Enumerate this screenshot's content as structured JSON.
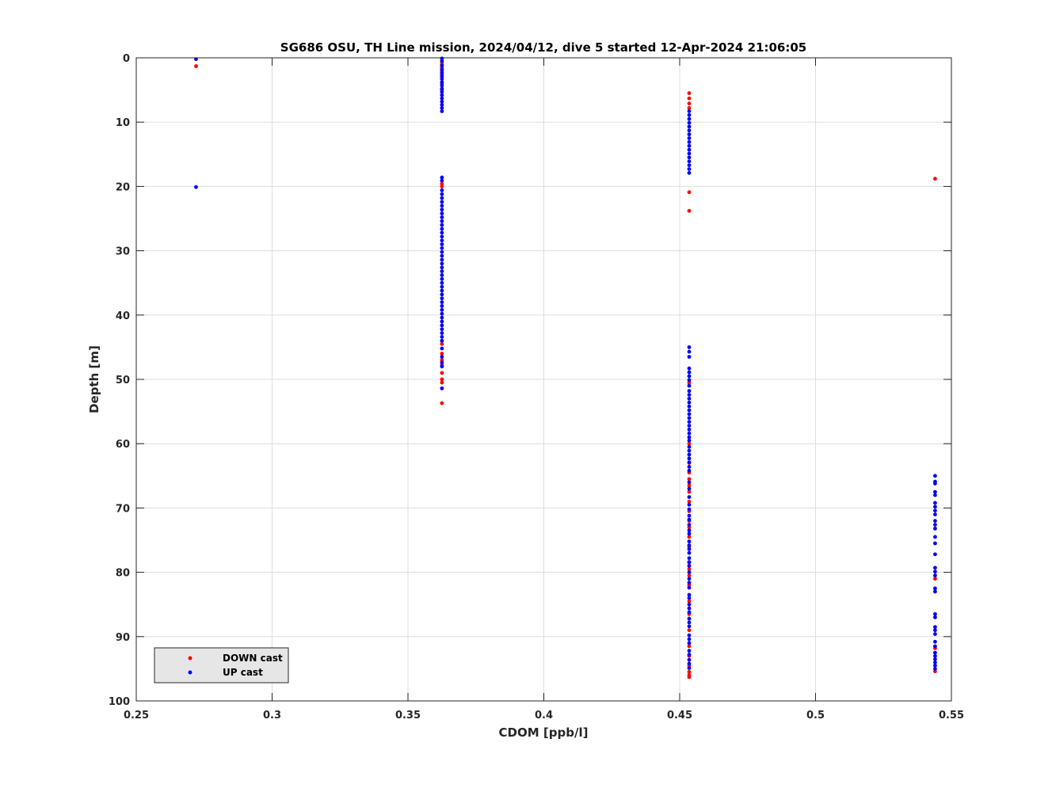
{
  "chart_data": {
    "type": "scatter",
    "title": "SG686 OSU, TH Line mission, 2024/04/12, dive 5 started 12-Apr-2024 21:06:05",
    "xlabel": "CDOM [ppb/l]",
    "ylabel": "Depth [m]",
    "xlim": [
      0.25,
      0.55
    ],
    "ylim": [
      0,
      100
    ],
    "y_reversed": true,
    "grid": true,
    "legend_position": "bottom-left",
    "xticks": [
      0.25,
      0.3,
      0.35,
      0.4,
      0.45,
      0.5,
      0.55
    ],
    "xtick_labels": [
      "0.25",
      "0.3",
      "0.35",
      "0.4",
      "0.45",
      "0.5",
      "0.55"
    ],
    "yticks": [
      0,
      10,
      20,
      30,
      40,
      50,
      60,
      70,
      80,
      90,
      100
    ],
    "ytick_labels": [
      "0",
      "10",
      "20",
      "30",
      "40",
      "50",
      "60",
      "70",
      "80",
      "90",
      "100"
    ],
    "series": [
      {
        "name": "DOWN cast",
        "color": "#ff0000",
        "points": [
          [
            0.272,
            1.3
          ],
          [
            0.3625,
            0.6
          ],
          [
            0.3625,
            1.0
          ],
          [
            0.3625,
            1.5
          ],
          [
            0.3625,
            2.0
          ],
          [
            0.3625,
            2.5
          ],
          [
            0.3625,
            3.0
          ],
          [
            0.3625,
            4.0
          ],
          [
            0.3625,
            5.0
          ],
          [
            0.3625,
            19.6
          ],
          [
            0.3625,
            20.0
          ],
          [
            0.3625,
            44.5
          ],
          [
            0.3625,
            46.0
          ],
          [
            0.3625,
            47.0
          ],
          [
            0.3625,
            47.8
          ],
          [
            0.3625,
            49.0
          ],
          [
            0.3625,
            50.0
          ],
          [
            0.3625,
            50.5
          ],
          [
            0.3625,
            53.7
          ],
          [
            0.4535,
            5.5
          ],
          [
            0.4535,
            6.3
          ],
          [
            0.4535,
            7.1
          ],
          [
            0.4535,
            7.8
          ],
          [
            0.4535,
            20.9
          ],
          [
            0.4535,
            23.8
          ],
          [
            0.4535,
            50.5
          ],
          [
            0.4535,
            60.0
          ],
          [
            0.4535,
            63.0
          ],
          [
            0.4535,
            64.5
          ],
          [
            0.4535,
            65.5
          ],
          [
            0.4535,
            66.5
          ],
          [
            0.4535,
            67.5
          ],
          [
            0.4535,
            69.0
          ],
          [
            0.4535,
            70.5
          ],
          [
            0.4535,
            72.0
          ],
          [
            0.4535,
            73.0
          ],
          [
            0.4535,
            74.5
          ],
          [
            0.4535,
            76.0
          ],
          [
            0.4535,
            78.5
          ],
          [
            0.4535,
            79.5
          ],
          [
            0.4535,
            80.5
          ],
          [
            0.4535,
            82.0
          ],
          [
            0.4535,
            84.5
          ],
          [
            0.4535,
            86.5
          ],
          [
            0.4535,
            89.0
          ],
          [
            0.4535,
            91.5
          ],
          [
            0.4535,
            93.0
          ],
          [
            0.4535,
            94.5
          ],
          [
            0.4535,
            95.5
          ],
          [
            0.4535,
            96.0
          ],
          [
            0.4535,
            96.3
          ],
          [
            0.544,
            18.8
          ],
          [
            0.544,
            81.0
          ],
          [
            0.544,
            91.8
          ],
          [
            0.544,
            95.4
          ]
        ]
      },
      {
        "name": "UP cast",
        "color": "#0000ff",
        "points": [
          [
            0.272,
            0.2
          ],
          [
            0.272,
            20.1
          ],
          [
            0.3625,
            0.1
          ],
          [
            0.3625,
            0.5
          ],
          [
            0.3625,
            1.2
          ],
          [
            0.3625,
            1.8
          ],
          [
            0.3625,
            2.3
          ],
          [
            0.3625,
            2.8
          ],
          [
            0.3625,
            3.3
          ],
          [
            0.3625,
            3.8
          ],
          [
            0.3625,
            4.3
          ],
          [
            0.3625,
            4.8
          ],
          [
            0.3625,
            5.3
          ],
          [
            0.3625,
            5.8
          ],
          [
            0.3625,
            6.3
          ],
          [
            0.3625,
            6.8
          ],
          [
            0.3625,
            7.3
          ],
          [
            0.3625,
            7.8
          ],
          [
            0.3625,
            8.3
          ],
          [
            0.3625,
            18.6
          ],
          [
            0.3625,
            19.1
          ],
          [
            0.3625,
            20.6
          ],
          [
            0.3625,
            21.2
          ],
          [
            0.3625,
            21.8
          ],
          [
            0.3625,
            22.4
          ],
          [
            0.3625,
            23.0
          ],
          [
            0.3625,
            23.6
          ],
          [
            0.3625,
            24.2
          ],
          [
            0.3625,
            24.8
          ],
          [
            0.3625,
            25.4
          ],
          [
            0.3625,
            26.0
          ],
          [
            0.3625,
            26.6
          ],
          [
            0.3625,
            27.2
          ],
          [
            0.3625,
            27.8
          ],
          [
            0.3625,
            28.4
          ],
          [
            0.3625,
            29.0
          ],
          [
            0.3625,
            29.6
          ],
          [
            0.3625,
            30.2
          ],
          [
            0.3625,
            30.8
          ],
          [
            0.3625,
            31.4
          ],
          [
            0.3625,
            32.0
          ],
          [
            0.3625,
            32.6
          ],
          [
            0.3625,
            33.2
          ],
          [
            0.3625,
            33.8
          ],
          [
            0.3625,
            34.4
          ],
          [
            0.3625,
            35.0
          ],
          [
            0.3625,
            35.6
          ],
          [
            0.3625,
            36.2
          ],
          [
            0.3625,
            36.8
          ],
          [
            0.3625,
            37.4
          ],
          [
            0.3625,
            38.0
          ],
          [
            0.3625,
            38.6
          ],
          [
            0.3625,
            39.2
          ],
          [
            0.3625,
            39.8
          ],
          [
            0.3625,
            40.4
          ],
          [
            0.3625,
            41.0
          ],
          [
            0.3625,
            41.6
          ],
          [
            0.3625,
            42.2
          ],
          [
            0.3625,
            42.8
          ],
          [
            0.3625,
            43.4
          ],
          [
            0.3625,
            44.0
          ],
          [
            0.3625,
            45.2
          ],
          [
            0.3625,
            46.5
          ],
          [
            0.3625,
            47.4
          ],
          [
            0.3625,
            48.0
          ],
          [
            0.3625,
            51.4
          ],
          [
            0.4535,
            8.3
          ],
          [
            0.4535,
            8.9
          ],
          [
            0.4535,
            9.5
          ],
          [
            0.4535,
            10.1
          ],
          [
            0.4535,
            10.7
          ],
          [
            0.4535,
            11.3
          ],
          [
            0.4535,
            11.9
          ],
          [
            0.4535,
            12.5
          ],
          [
            0.4535,
            13.1
          ],
          [
            0.4535,
            13.7
          ],
          [
            0.4535,
            14.3
          ],
          [
            0.4535,
            14.9
          ],
          [
            0.4535,
            15.5
          ],
          [
            0.4535,
            16.1
          ],
          [
            0.4535,
            16.7
          ],
          [
            0.4535,
            17.3
          ],
          [
            0.4535,
            17.9
          ],
          [
            0.4535,
            45.0
          ],
          [
            0.4535,
            45.7
          ],
          [
            0.4535,
            46.5
          ],
          [
            0.4535,
            48.3
          ],
          [
            0.4535,
            48.9
          ],
          [
            0.4535,
            49.5
          ],
          [
            0.4535,
            50.1
          ],
          [
            0.4535,
            51.0
          ],
          [
            0.4535,
            51.8
          ],
          [
            0.4535,
            52.4
          ],
          [
            0.4535,
            53.0
          ],
          [
            0.4535,
            53.6
          ],
          [
            0.4535,
            54.2
          ],
          [
            0.4535,
            54.8
          ],
          [
            0.4535,
            55.4
          ],
          [
            0.4535,
            56.0
          ],
          [
            0.4535,
            56.6
          ],
          [
            0.4535,
            57.2
          ],
          [
            0.4535,
            57.8
          ],
          [
            0.4535,
            58.4
          ],
          [
            0.4535,
            59.0
          ],
          [
            0.4535,
            59.5
          ],
          [
            0.4535,
            60.5
          ],
          [
            0.4535,
            61.1
          ],
          [
            0.4535,
            61.7
          ],
          [
            0.4535,
            62.3
          ],
          [
            0.4535,
            62.9
          ],
          [
            0.4535,
            63.6
          ],
          [
            0.4535,
            64.2
          ],
          [
            0.4535,
            66.0
          ],
          [
            0.4535,
            67.0
          ],
          [
            0.4535,
            68.3
          ],
          [
            0.4535,
            69.5
          ],
          [
            0.4535,
            70.2
          ],
          [
            0.4535,
            71.2
          ],
          [
            0.4535,
            71.8
          ],
          [
            0.4535,
            72.6
          ],
          [
            0.4535,
            73.5
          ],
          [
            0.4535,
            74.0
          ],
          [
            0.4535,
            75.2
          ],
          [
            0.4535,
            75.8
          ],
          [
            0.4535,
            76.4
          ],
          [
            0.4535,
            77.0
          ],
          [
            0.4535,
            77.8
          ],
          [
            0.4535,
            78.4
          ],
          [
            0.4535,
            79.0
          ],
          [
            0.4535,
            80.0
          ],
          [
            0.4535,
            81.0
          ],
          [
            0.4535,
            81.6
          ],
          [
            0.4535,
            82.4
          ],
          [
            0.4535,
            83.5
          ],
          [
            0.4535,
            84.0
          ],
          [
            0.4535,
            85.0
          ],
          [
            0.4535,
            85.6
          ],
          [
            0.4535,
            86.2
          ],
          [
            0.4535,
            87.2
          ],
          [
            0.4535,
            87.8
          ],
          [
            0.4535,
            88.4
          ],
          [
            0.4535,
            89.8
          ],
          [
            0.4535,
            90.4
          ],
          [
            0.4535,
            91.0
          ],
          [
            0.4535,
            92.2
          ],
          [
            0.4535,
            92.8
          ],
          [
            0.4535,
            93.6
          ],
          [
            0.4535,
            94.2
          ],
          [
            0.4535,
            94.9
          ],
          [
            0.544,
            65.0
          ],
          [
            0.544,
            65.9
          ],
          [
            0.544,
            66.2
          ],
          [
            0.544,
            67.5
          ],
          [
            0.544,
            68.0
          ],
          [
            0.544,
            69.2
          ],
          [
            0.544,
            69.8
          ],
          [
            0.544,
            70.4
          ],
          [
            0.544,
            71.0
          ],
          [
            0.544,
            72.0
          ],
          [
            0.544,
            72.6
          ],
          [
            0.544,
            73.2
          ],
          [
            0.544,
            74.5
          ],
          [
            0.544,
            75.5
          ],
          [
            0.544,
            77.2
          ],
          [
            0.544,
            79.3
          ],
          [
            0.544,
            79.9
          ],
          [
            0.544,
            80.5
          ],
          [
            0.544,
            82.5
          ],
          [
            0.544,
            83.0
          ],
          [
            0.544,
            86.5
          ],
          [
            0.544,
            87.0
          ],
          [
            0.544,
            88.5
          ],
          [
            0.544,
            89.0
          ],
          [
            0.544,
            89.6
          ],
          [
            0.544,
            90.8
          ],
          [
            0.544,
            91.5
          ],
          [
            0.544,
            92.5
          ],
          [
            0.544,
            93.0
          ],
          [
            0.544,
            93.5
          ],
          [
            0.544,
            94.0
          ],
          [
            0.544,
            94.5
          ],
          [
            0.544,
            95.0
          ]
        ]
      }
    ]
  }
}
